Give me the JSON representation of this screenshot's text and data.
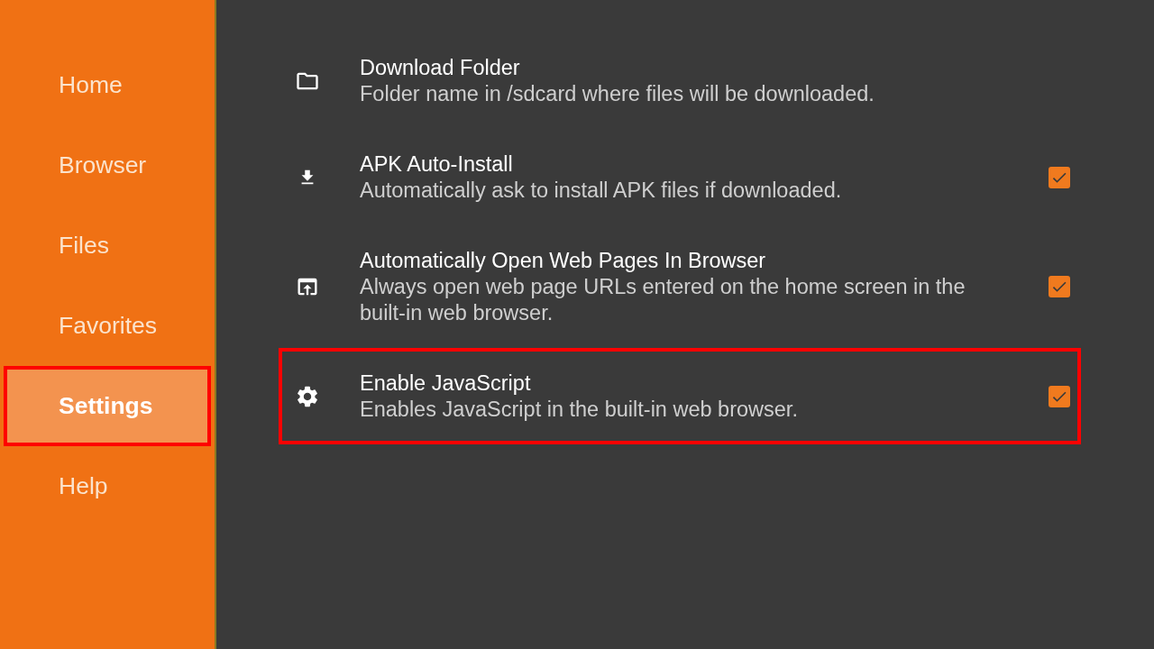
{
  "sidebar": {
    "items": [
      {
        "label": "Home",
        "selected": false,
        "highlighted": false
      },
      {
        "label": "Browser",
        "selected": false,
        "highlighted": false
      },
      {
        "label": "Files",
        "selected": false,
        "highlighted": false
      },
      {
        "label": "Favorites",
        "selected": false,
        "highlighted": false
      },
      {
        "label": "Settings",
        "selected": true,
        "highlighted": true
      },
      {
        "label": "Help",
        "selected": false,
        "highlighted": false
      }
    ]
  },
  "settings": [
    {
      "kind": "text",
      "title": "Download Folder",
      "description": "Folder name in /sdcard where files will be downloaded.",
      "highlighted": false
    },
    {
      "kind": "checkbox",
      "title": "APK Auto-Install",
      "description": "Automatically ask to install APK files if downloaded.",
      "checked": true,
      "highlighted": false
    },
    {
      "kind": "checkbox",
      "title": "Automatically Open Web Pages In Browser",
      "description": "Always open web page URLs entered on the home screen in the built-in web browser.",
      "checked": true,
      "highlighted": false
    },
    {
      "kind": "checkbox",
      "title": "Enable JavaScript",
      "description": "Enables JavaScript in the built-in web browser.",
      "checked": true,
      "highlighted": true
    }
  ]
}
